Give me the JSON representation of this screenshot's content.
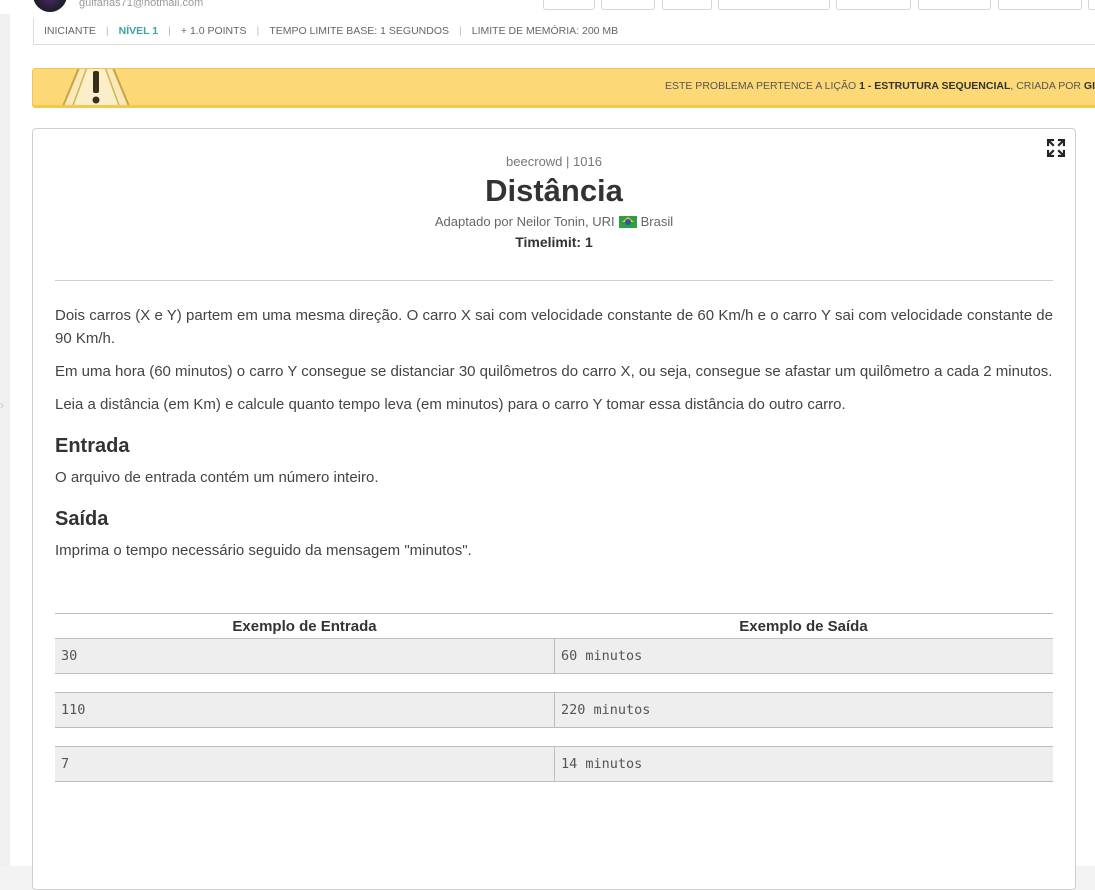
{
  "user": {
    "email": "guifarias71@hotmail.com"
  },
  "info_strip": {
    "items": [
      "INICIANTE",
      "NÍVEL 1",
      "+ 1.0 POINTS",
      "TEMPO LIMITE BASE: 1 SEGUNDOS",
      "LIMITE DE MEMÓRIA: 200 MB"
    ]
  },
  "notice": {
    "prefix": "ESTE PROBLEMA PERTENCE A LIÇÃO ",
    "lesson": "1 - ESTRUTURA SEQUENCIAL",
    "suffix": ", CRIADA POR ",
    "author_partial": "GI"
  },
  "problem": {
    "provider": "beecrowd | 1016",
    "title": "Distância",
    "adapted_by": "Adaptado por Neilor Tonin, URI",
    "country": "Brasil",
    "timelimit": "Timelimit: 1",
    "paragraphs": [
      "Dois carros (X e Y) partem em uma mesma direção. O carro X sai com velocidade constante de 60 Km/h e o carro Y sai com velocidade constante de 90 Km/h.",
      "Em uma hora (60 minutos) o carro Y consegue se distanciar 30 quilômetros do carro X, ou seja, consegue se afastar um quilômetro a cada 2 minutos.",
      "Leia a distância (em Km) e calcule quanto tempo leva (em minutos) para o carro Y tomar essa distância do outro carro."
    ],
    "input_heading": "Entrada",
    "input_text": "O arquivo de entrada contém um número inteiro.",
    "output_heading": "Saída",
    "output_text": "Imprima o tempo necessário seguido da mensagem \"minutos\"."
  },
  "examples": {
    "input_header": "Exemplo de Entrada",
    "output_header": "Exemplo de Saída",
    "rows": [
      {
        "input": "30",
        "output": "60 minutos"
      },
      {
        "input": "110",
        "output": "220 minutos"
      },
      {
        "input": "7",
        "output": "14 minutos"
      }
    ]
  },
  "icons": {
    "expand": "fullscreen-expand-icon",
    "warning": "warning-triangle-icon",
    "flag": "brazil-flag-icon"
  }
}
